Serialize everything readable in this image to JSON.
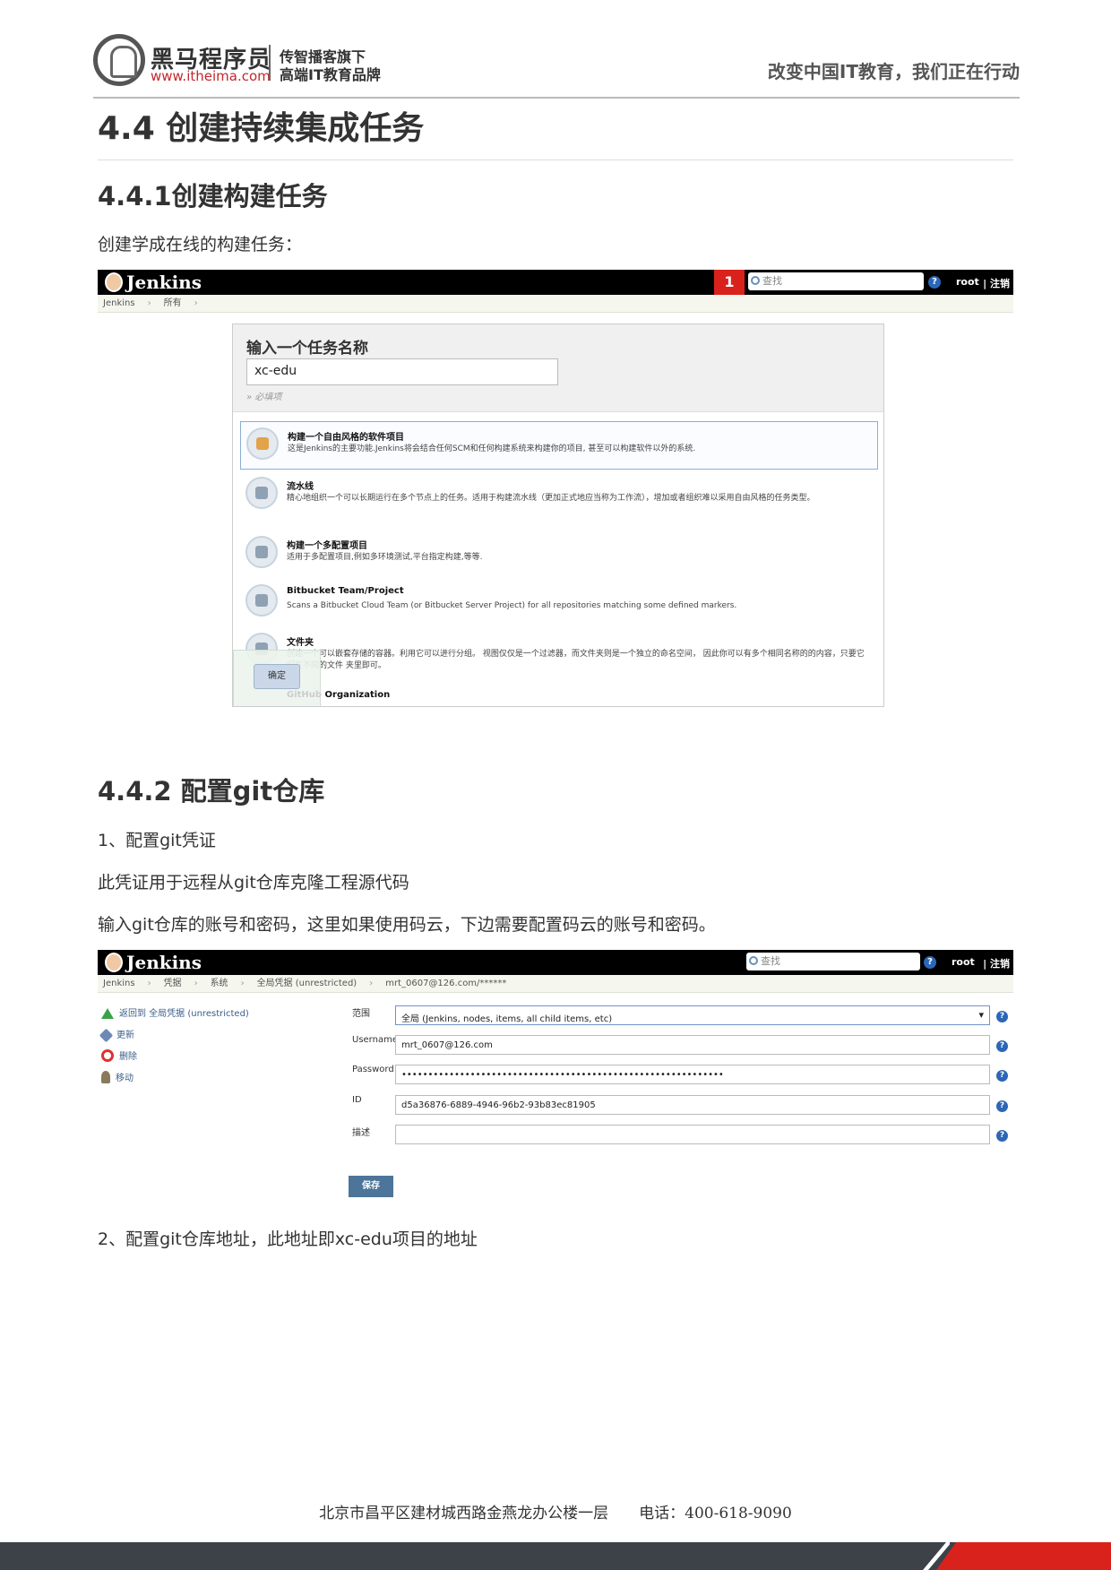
{
  "header": {
    "brand_name": "黑马程序员",
    "brand_url": "www.itheima.com",
    "brand_sub1": "传智播客旗下",
    "brand_sub2": "高端IT教育品牌",
    "slogan": "改变中国IT教育，我们正在行动"
  },
  "section_title": "4.4 创建持续集成任务",
  "sub1": {
    "title": "4.4.1创建构建任务",
    "intro": "创建学成在线的构建任务："
  },
  "jenkins1": {
    "logo": "Jenkins",
    "badge": "1",
    "search_placeholder": "查找",
    "help": "?",
    "user": "root",
    "logout": "| 注销",
    "crumbs": [
      "Jenkins",
      "所有"
    ],
    "label": "输入一个任务名称",
    "input_value": "xc-edu",
    "required": "» 必填项",
    "items": [
      {
        "title": "构建一个自由风格的软件项目",
        "desc": "这是Jenkins的主要功能.Jenkins将会结合任何SCM和任何构建系统来构建你的项目, 甚至可以构建软件以外的系统."
      },
      {
        "title": "流水线",
        "desc": "精心地组织一个可以长期运行在多个节点上的任务。适用于构建流水线（更加正式地应当称为工作流），增加或者组织难以采用自由风格的任务类型。"
      },
      {
        "title": "构建一个多配置项目",
        "desc": "适用于多配置项目,例如多环境测试,平台指定构建,等等."
      },
      {
        "title": "Bitbucket Team/Project",
        "desc": "Scans a Bitbucket Cloud Team (or Bitbucket Server Project) for all repositories matching some defined markers."
      },
      {
        "title": "文件夹",
        "desc": "创建一个可以嵌套存储的容器。利用它可以进行分组。 视图仅仅是一个过滤器，而文件夹则是一个独立的命名空间， 因此你可以有多个相同名称的的内容，只要它们在不同的文件 夹里即可。"
      }
    ],
    "ok": "确定",
    "github_prefix": "GitHub",
    "github_suffix": " Organization"
  },
  "sub2": {
    "title": "4.4.2 配置git仓库",
    "p1": "1、配置git凭证",
    "p2": "此凭证用于远程从git仓库克隆工程源代码",
    "p3": "输入git仓库的账号和密码，这里如果使用码云，下边需要配置码云的账号和密码。",
    "p4": "2、配置git仓库地址，此地址即xc-edu项目的地址"
  },
  "jenkins2": {
    "logo": "Jenkins",
    "search_placeholder": "查找",
    "help": "?",
    "user": "root",
    "logout": "| 注销",
    "crumbs": [
      "Jenkins",
      "凭据",
      "系统",
      "全局凭据 (unrestricted)",
      "mrt_0607@126.com/******"
    ],
    "side": [
      "返回到 全局凭据 (unrestricted)",
      "更新",
      "删除",
      "移动"
    ],
    "fields": [
      {
        "label": "范围",
        "value": "全局 (Jenkins, nodes, items, all child items, etc)"
      },
      {
        "label": "Username",
        "value": "mrt_0607@126.com"
      },
      {
        "label": "Password",
        "value": "•••••••••••••••••••••••••••••••••••••••••••••••••••••••••••••"
      },
      {
        "label": "ID",
        "value": "d5a36876-6889-4946-96b2-93b83ec81905"
      },
      {
        "label": "描述",
        "value": ""
      }
    ],
    "save": "保存"
  },
  "footer": {
    "text": "北京市昌平区建材城西路金燕龙办公楼一层　　电话：400-618-9090"
  }
}
